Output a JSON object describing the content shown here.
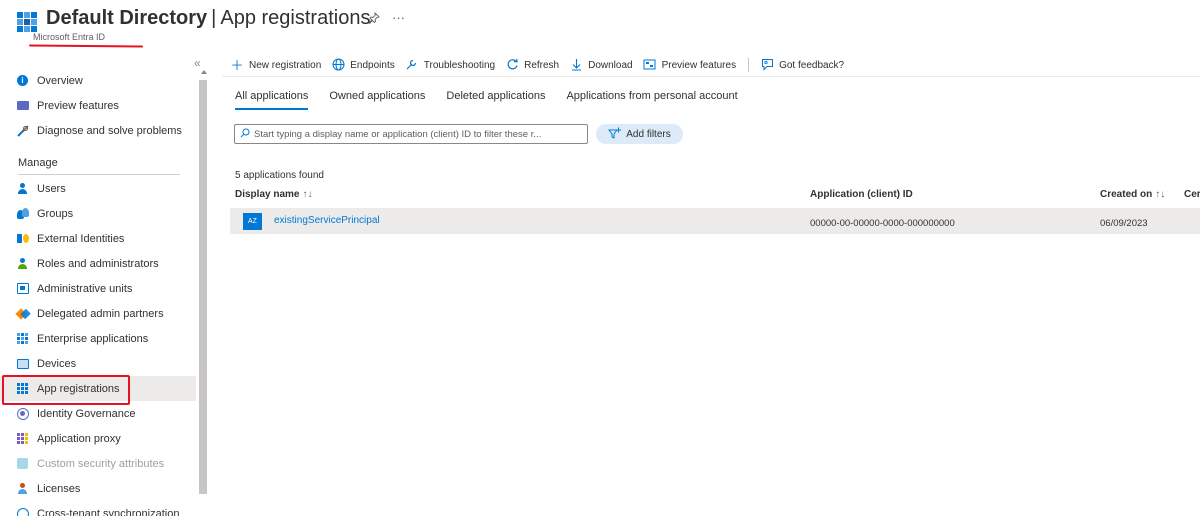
{
  "header": {
    "title_bold": "Default Directory",
    "separator": "|",
    "title_rest": "App registrations",
    "subtitle": "Microsoft Entra ID",
    "pin_icon": "pin-icon",
    "more_label": "···"
  },
  "sidebar": {
    "collapse_label": "«",
    "section_manage": "Manage",
    "items": [
      {
        "label": "Overview",
        "icon": "info-icon"
      },
      {
        "label": "Preview features",
        "icon": "preview-icon"
      },
      {
        "label": "Diagnose and solve problems",
        "icon": "wrench-icon"
      },
      {
        "label": "Users",
        "icon": "user-icon"
      },
      {
        "label": "Groups",
        "icon": "groups-icon"
      },
      {
        "label": "External Identities",
        "icon": "external-identities-icon"
      },
      {
        "label": "Roles and administrators",
        "icon": "roles-icon"
      },
      {
        "label": "Administrative units",
        "icon": "admin-units-icon"
      },
      {
        "label": "Delegated admin partners",
        "icon": "delegated-icon"
      },
      {
        "label": "Enterprise applications",
        "icon": "enterprise-apps-icon"
      },
      {
        "label": "Devices",
        "icon": "devices-icon"
      },
      {
        "label": "App registrations",
        "icon": "app-registrations-icon"
      },
      {
        "label": "Identity Governance",
        "icon": "identity-governance-icon"
      },
      {
        "label": "Application proxy",
        "icon": "app-proxy-icon"
      },
      {
        "label": "Custom security attributes",
        "icon": "custom-attributes-icon"
      },
      {
        "label": "Licenses",
        "icon": "licenses-icon"
      },
      {
        "label": "Cross-tenant synchronization",
        "icon": "cross-tenant-icon"
      }
    ]
  },
  "toolbar": {
    "new_registration": "New registration",
    "endpoints": "Endpoints",
    "troubleshooting": "Troubleshooting",
    "refresh": "Refresh",
    "download": "Download",
    "preview_features": "Preview features",
    "got_feedback": "Got feedback?"
  },
  "tabs": [
    "All applications",
    "Owned applications",
    "Deleted applications",
    "Applications from personal account"
  ],
  "filter": {
    "placeholder": "Start typing a display name or application (client) ID to filter these r...",
    "add_filters": "Add filters"
  },
  "table": {
    "count_text": "5 applications found",
    "col_display_name": "Display name",
    "col_display_name_sort": "↑↓",
    "col_app_id": "Application (client) ID",
    "col_created": "Created on",
    "col_created_sort": "↑↓",
    "col_cert": "Cer",
    "rows": [
      {
        "badge": "AZ",
        "name": "existingServicePrincipal",
        "app_id": "00000-00-00000-0000-000000000",
        "created": "06/09/2023"
      }
    ]
  },
  "colors": {
    "accent": "#0078d4",
    "highlight_red": "#e81123",
    "selected_bg": "#edebe9"
  }
}
